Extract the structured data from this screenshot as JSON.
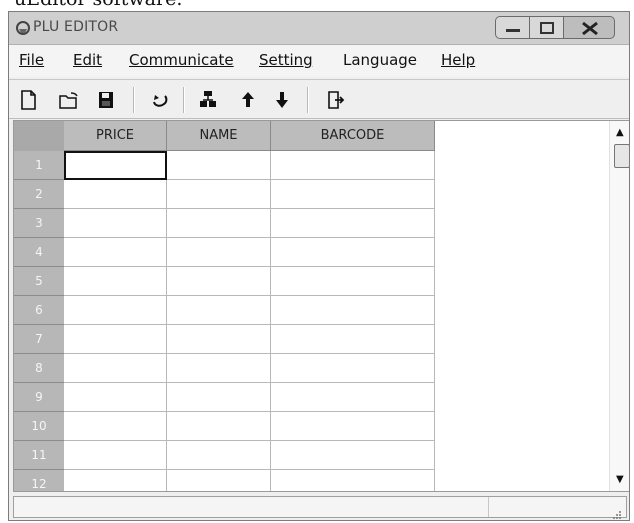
{
  "document": {
    "fragment_text": "uEditor software."
  },
  "window": {
    "title": "PLU EDITOR",
    "controls": [
      "minimize",
      "maximize",
      "close"
    ]
  },
  "menu": [
    {
      "label": "File"
    },
    {
      "label": "Edit"
    },
    {
      "label": "Communicate"
    },
    {
      "label": "Setting"
    },
    {
      "label": "Language"
    },
    {
      "label": "Help"
    }
  ],
  "toolbar": {
    "icons": [
      "new-document-icon",
      "open-folder-icon",
      "save-disk-icon",
      "refresh-icon",
      "communication-icon",
      "upload-arrow-icon",
      "download-arrow-icon",
      "exit-icon"
    ]
  },
  "table": {
    "columns": [
      "PRICE",
      "NAME",
      "BARCODE"
    ],
    "rows": [
      {
        "index": "1",
        "values": [
          "",
          "",
          ""
        ]
      },
      {
        "index": "2",
        "values": [
          "",
          "",
          ""
        ]
      },
      {
        "index": "3",
        "values": [
          "",
          "",
          ""
        ]
      },
      {
        "index": "4",
        "values": [
          "",
          "",
          ""
        ]
      },
      {
        "index": "5",
        "values": [
          "",
          "",
          ""
        ]
      },
      {
        "index": "6",
        "values": [
          "",
          "",
          ""
        ]
      },
      {
        "index": "7",
        "values": [
          "",
          "",
          ""
        ]
      },
      {
        "index": "8",
        "values": [
          "",
          "",
          ""
        ]
      },
      {
        "index": "9",
        "values": [
          "",
          "",
          ""
        ]
      },
      {
        "index": "10",
        "values": [
          "",
          "",
          ""
        ]
      },
      {
        "index": "11",
        "values": [
          "",
          "",
          ""
        ]
      },
      {
        "index": "12",
        "values": [
          "",
          "",
          ""
        ]
      }
    ]
  },
  "status_bar": {
    "text": ""
  },
  "colors": {
    "title_bar": "#cfcfcf",
    "window_bg": "#efefef",
    "header_bg": "#bcbcbc",
    "active_cell_border": "#111111"
  }
}
